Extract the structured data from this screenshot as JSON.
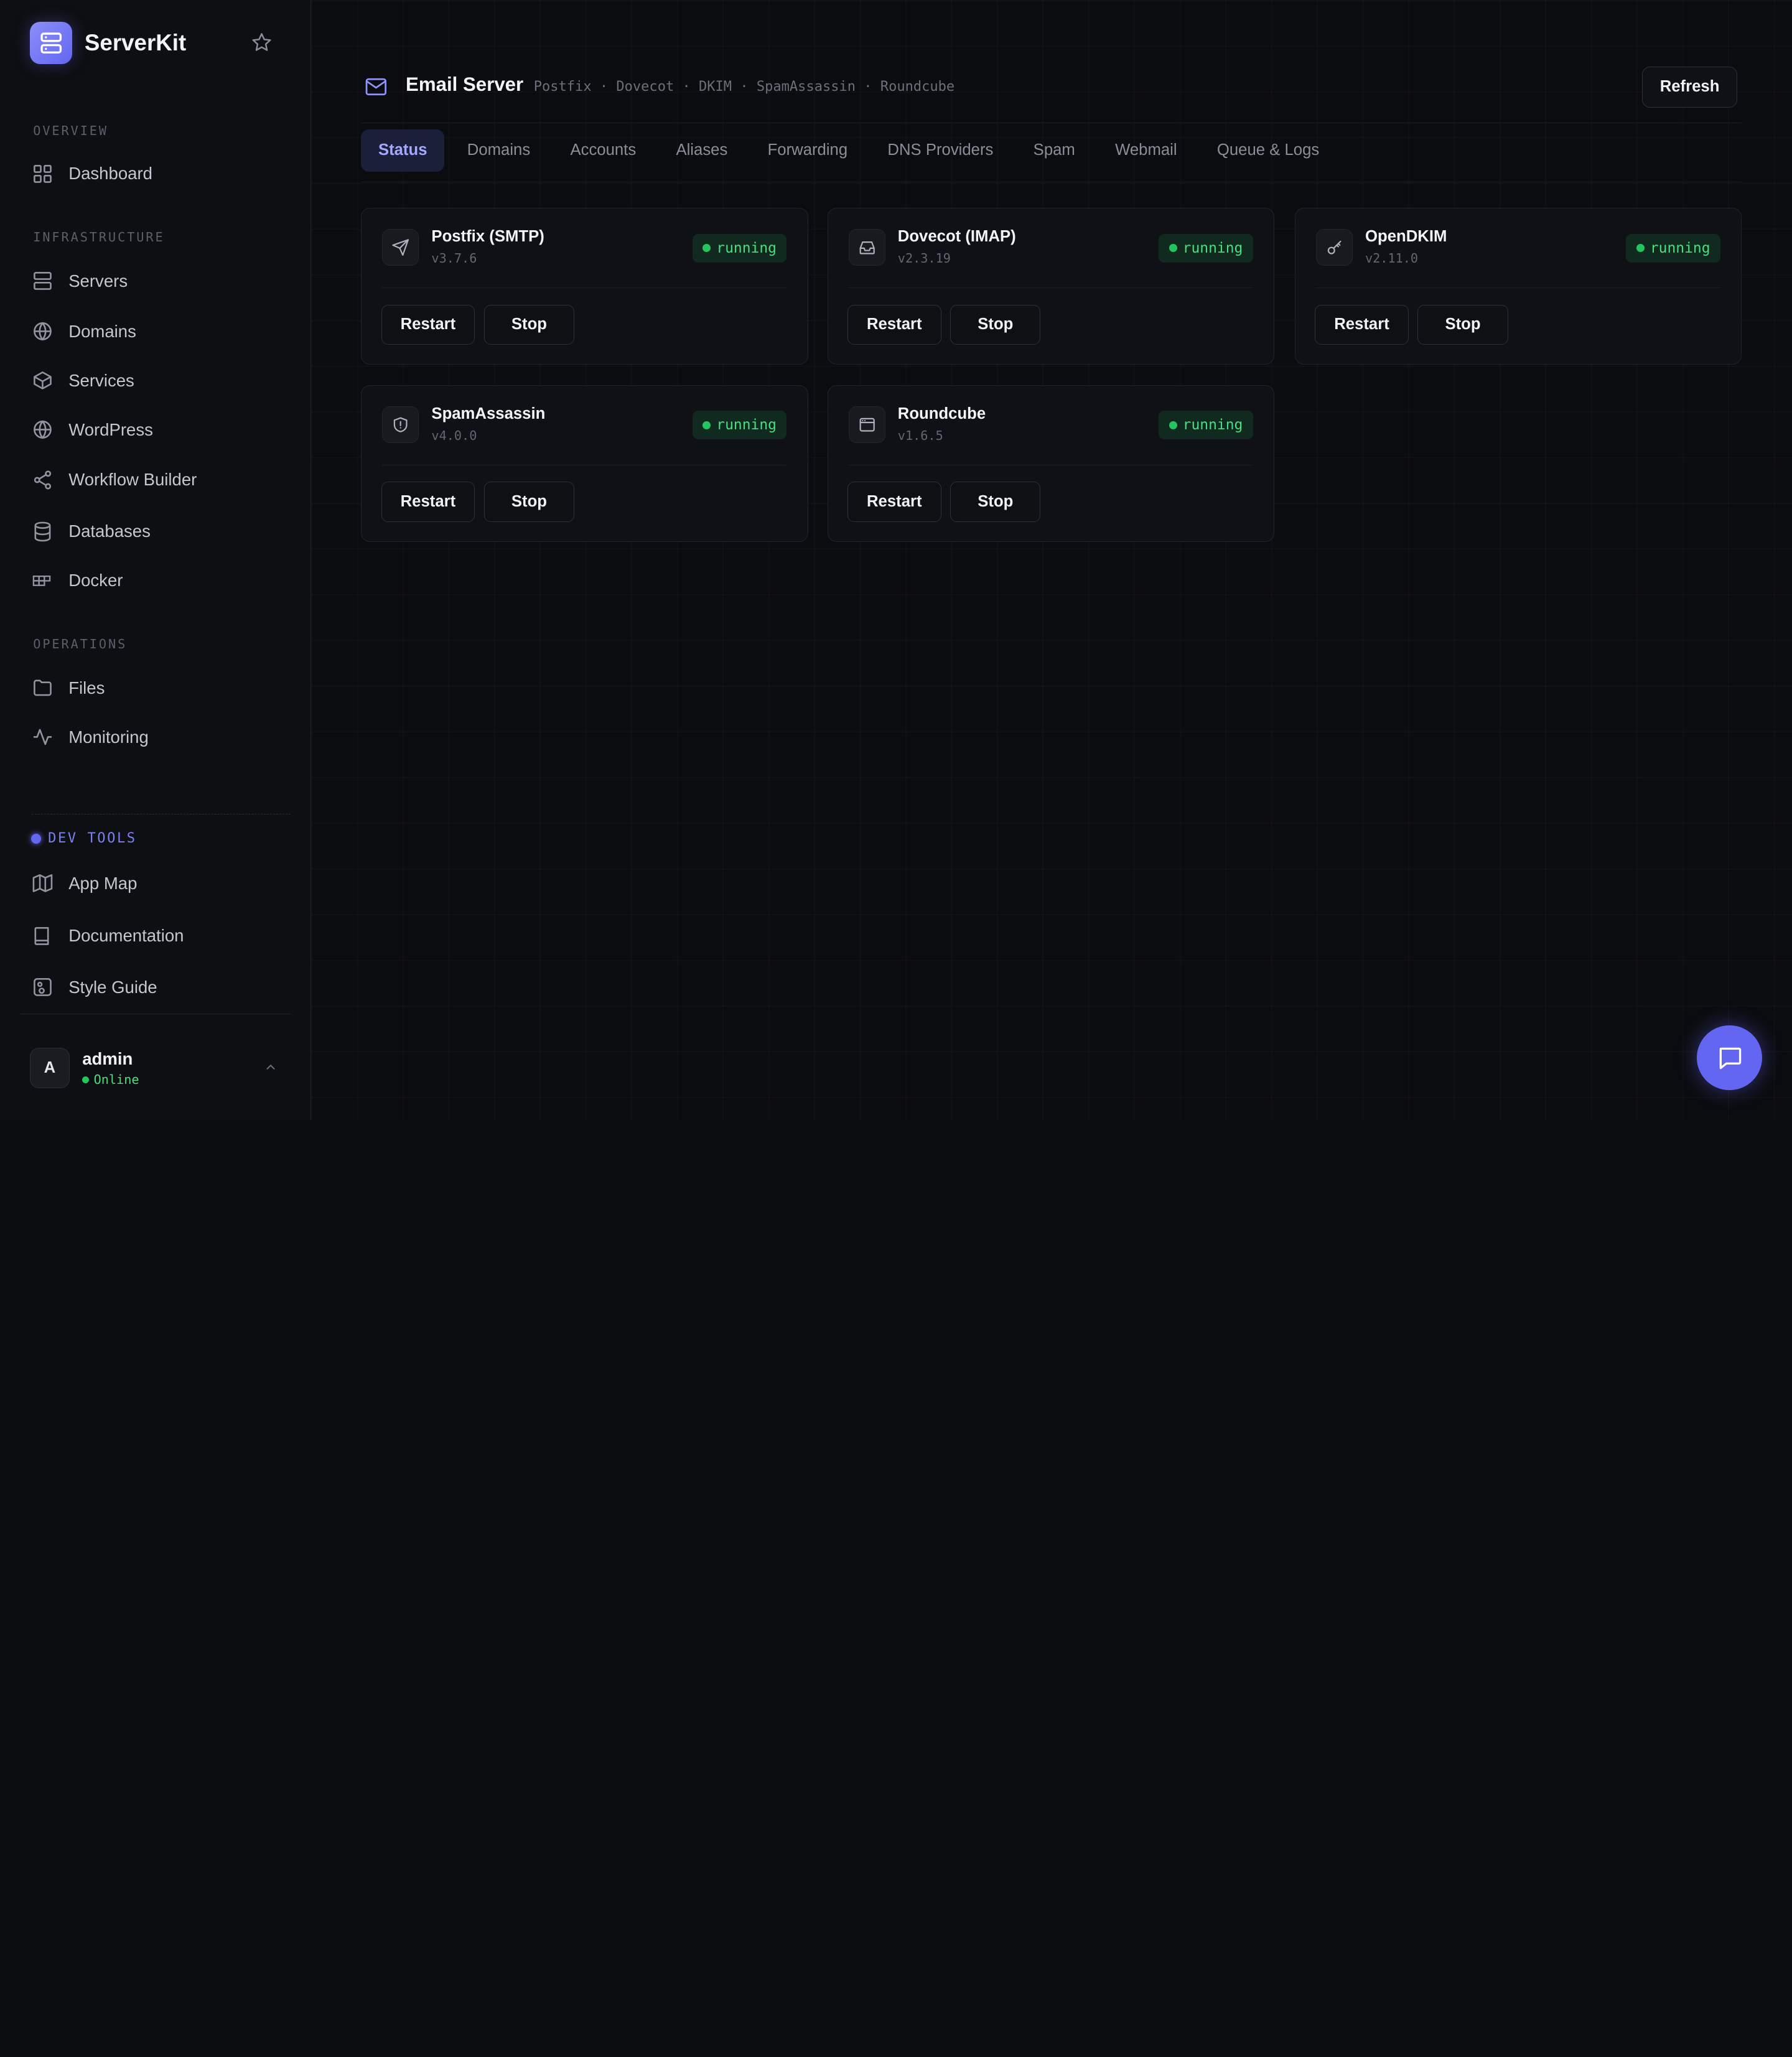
{
  "brand": {
    "name": "ServerKit"
  },
  "sidebar": {
    "sections": {
      "overview": "OVERVIEW",
      "infrastructure": "INFRASTRUCTURE",
      "operations": "OPERATIONS",
      "dev_tools": "DEV TOOLS"
    },
    "items": {
      "dashboard": "Dashboard",
      "servers": "Servers",
      "domains": "Domains",
      "services": "Services",
      "wordpress": "WordPress",
      "workflow_builder": "Workflow Builder",
      "databases": "Databases",
      "docker": "Docker",
      "files": "Files",
      "monitoring": "Monitoring",
      "app_map": "App Map",
      "documentation": "Documentation",
      "style_guide": "Style Guide"
    },
    "user": {
      "initial": "A",
      "name": "admin",
      "status": "Online"
    }
  },
  "header": {
    "title": "Email Server",
    "subtitle": "Postfix · Dovecot · DKIM · SpamAssassin · Roundcube",
    "refresh_label": "Refresh"
  },
  "tabs": [
    "Status",
    "Domains",
    "Accounts",
    "Aliases",
    "Forwarding",
    "DNS Providers",
    "Spam",
    "Webmail",
    "Queue & Logs"
  ],
  "active_tab": "Status",
  "services": [
    {
      "name": "Postfix (SMTP)",
      "version": "v3.7.6",
      "status": "running",
      "icon": "send-icon",
      "restart": "Restart",
      "stop": "Stop"
    },
    {
      "name": "Dovecot (IMAP)",
      "version": "v2.3.19",
      "status": "running",
      "icon": "inbox-icon",
      "restart": "Restart",
      "stop": "Stop"
    },
    {
      "name": "OpenDKIM",
      "version": "v2.11.0",
      "status": "running",
      "icon": "key-icon",
      "restart": "Restart",
      "stop": "Stop"
    },
    {
      "name": "SpamAssassin",
      "version": "v4.0.0",
      "status": "running",
      "icon": "shield-alert-icon",
      "restart": "Restart",
      "stop": "Stop"
    },
    {
      "name": "Roundcube",
      "version": "v1.6.5",
      "status": "running",
      "icon": "browser-window-icon",
      "restart": "Restart",
      "stop": "Stop"
    }
  ],
  "colors": {
    "accent": "#6366f1",
    "running": "#4ade80",
    "background": "#0b0c10"
  }
}
